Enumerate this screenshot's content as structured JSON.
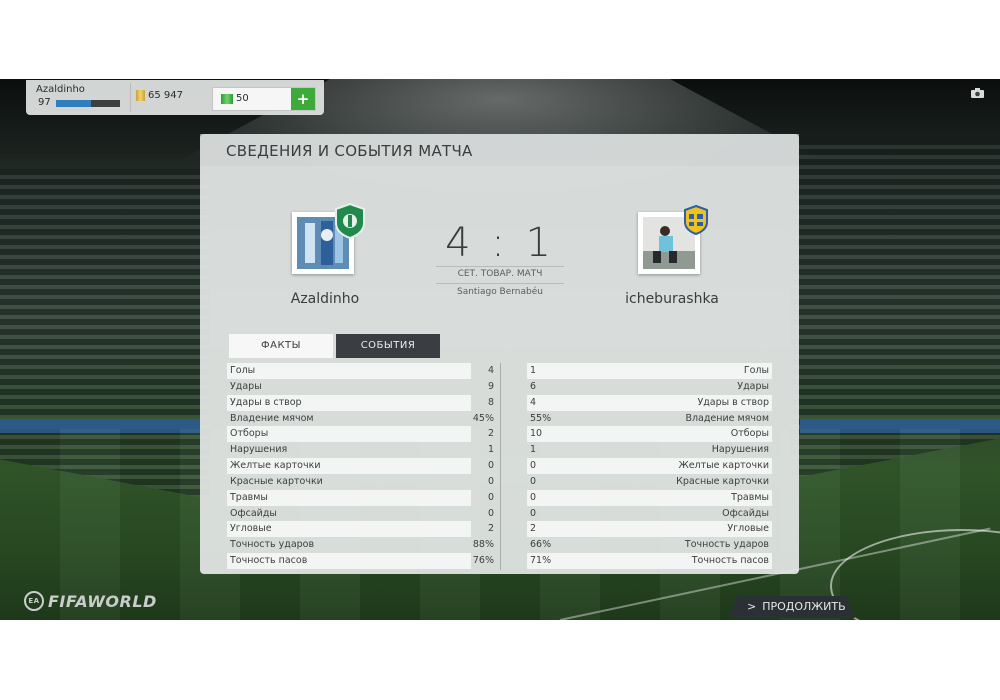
{
  "header": {
    "user_name": "Azaldinho",
    "user_level": "97",
    "xp_progress_pct": 55,
    "coins": "65 947",
    "points": "50",
    "add_label": "+"
  },
  "panel": {
    "title": "СВЕДЕНИЯ И СОБЫТИЯ МАТЧА",
    "home_team": "Azaldinho",
    "away_team": "icheburashka",
    "score": "4 : 1",
    "match_type": "СЕТ. ТОВАР. МАТЧ",
    "venue": "Santiago Bernabéu",
    "tabs": {
      "facts": "ФАКТЫ",
      "events": "СОБЫТИЯ"
    },
    "stats": [
      {
        "label": "Голы",
        "home": "4",
        "away": "1"
      },
      {
        "label": "Удары",
        "home": "9",
        "away": "6"
      },
      {
        "label": "Удары в створ",
        "home": "8",
        "away": "4"
      },
      {
        "label": "Владение мячом",
        "home": "45%",
        "away": "55%"
      },
      {
        "label": "Отборы",
        "home": "2",
        "away": "10"
      },
      {
        "label": "Нарушения",
        "home": "1",
        "away": "1"
      },
      {
        "label": "Желтые карточки",
        "home": "0",
        "away": "0"
      },
      {
        "label": "Красные карточки",
        "home": "0",
        "away": "0"
      },
      {
        "label": "Травмы",
        "home": "0",
        "away": "0"
      },
      {
        "label": "Офсайды",
        "home": "0",
        "away": "0"
      },
      {
        "label": "Угловые",
        "home": "2",
        "away": "2"
      },
      {
        "label": "Точность ударов",
        "home": "88%",
        "away": "66%"
      },
      {
        "label": "Точность пасов",
        "home": "76%",
        "away": "71%"
      }
    ]
  },
  "footer": {
    "brand": "FIFAWORLD",
    "ea": "EA",
    "continue_label": "ПРОДОЛЖИТЬ"
  },
  "colors": {
    "accent_green": "#3eaa3a",
    "xp_blue": "#2f7fbf",
    "dark_tab": "#3a3e42"
  }
}
